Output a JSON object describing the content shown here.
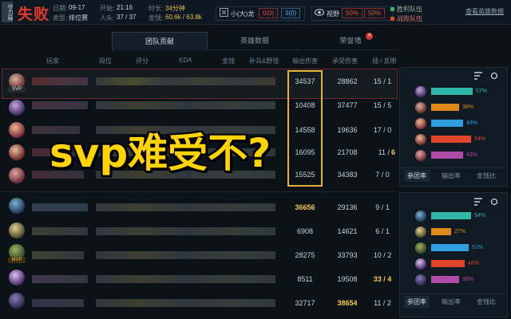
{
  "header": {
    "brand_tag": "守力局",
    "result": "失败",
    "date_label": "日期:",
    "date": "09-17",
    "start_label": "开始:",
    "start": "21:16",
    "duration_label": "时长:",
    "duration": "34分钟",
    "type_label": "类型:",
    "type": "排位赛",
    "kills_label": "人头:",
    "kills": "37 / 37",
    "gold_label": "金钱:",
    "gold": "60.6k / 63.8k",
    "dragon_label": "小(大)龙",
    "dragon_a": "0(0)",
    "dragon_b": "3(0)",
    "vision_label": "视野",
    "vision_a": "50%",
    "vision_b": "50%",
    "win_team": "胜利队伍",
    "lose_team": "战败队伍",
    "view_more": "查看英雄数据"
  },
  "tabs": [
    {
      "label": "团队贡献",
      "active": true
    },
    {
      "label": "英雄数据",
      "active": false
    },
    {
      "label": "荣誉墙",
      "active": false,
      "badge": "4"
    }
  ],
  "columns": [
    "玩家",
    "段位",
    "评分",
    "KDA",
    "金钱",
    "补兵&野怪",
    "输出伤害",
    "承受伤害",
    "插 / 反眼"
  ],
  "team1": [
    {
      "damage": "34537",
      "taken": "28862",
      "wards": "15 / 1",
      "wards_highlight": "",
      "badge": "SVP"
    },
    {
      "damage": "10408",
      "taken": "37477",
      "wards": "15 / 5",
      "wards_highlight": ""
    },
    {
      "damage": "14558",
      "taken": "19636",
      "wards": "17 / 0",
      "wards_highlight": ""
    },
    {
      "damage": "16095",
      "taken": "21708",
      "wards": "11 / ",
      "wards_highlight": "6"
    },
    {
      "damage": "15525",
      "taken": "34383",
      "wards": "7 / 0",
      "wards_highlight": ""
    }
  ],
  "team2": [
    {
      "damage": "36656",
      "damage_gold": true,
      "taken": "29136",
      "taken_gold": false,
      "wards": "9 / 1"
    },
    {
      "damage": "6908",
      "damage_gold": false,
      "taken": "14621",
      "taken_gold": false,
      "wards": "6 / 1"
    },
    {
      "damage": "28275",
      "damage_gold": false,
      "taken": "33793",
      "taken_gold": false,
      "wards": "10 / 2",
      "badge": "MVP"
    },
    {
      "damage": "8511",
      "damage_gold": false,
      "taken": "19508",
      "taken_gold": false,
      "wards": "33 / 4",
      "wards_gold": true
    },
    {
      "damage": "32717",
      "damage_gold": false,
      "taken": "38654",
      "taken_gold": true,
      "wards": "11 / 2"
    }
  ],
  "panel1": {
    "bars": [
      {
        "pct": "57%",
        "value": 0.57,
        "color": "#2fb8a8"
      },
      {
        "pct": "38%",
        "value": 0.38,
        "color": "#e08a1e"
      },
      {
        "pct": "43%",
        "value": 0.43,
        "color": "#2f9fe0"
      },
      {
        "pct": "54%",
        "value": 0.54,
        "color": "#e0452a"
      },
      {
        "pct": "43%",
        "value": 0.43,
        "color": "#b24aa8"
      }
    ],
    "tabs": [
      "参团率",
      "输出率",
      "金钱比"
    ]
  },
  "panel2": {
    "bars": [
      {
        "pct": "54%",
        "value": 0.54,
        "color": "#2fb8a8"
      },
      {
        "pct": "27%",
        "value": 0.27,
        "color": "#e08a1e"
      },
      {
        "pct": "51%",
        "value": 0.51,
        "color": "#2f9fe0"
      },
      {
        "pct": "46%",
        "value": 0.46,
        "color": "#e0452a"
      },
      {
        "pct": "38%",
        "value": 0.38,
        "color": "#b24aa8"
      }
    ],
    "tabs": [
      "参团率",
      "输出率",
      "金钱比"
    ]
  },
  "overlay": "svp难受不?"
}
